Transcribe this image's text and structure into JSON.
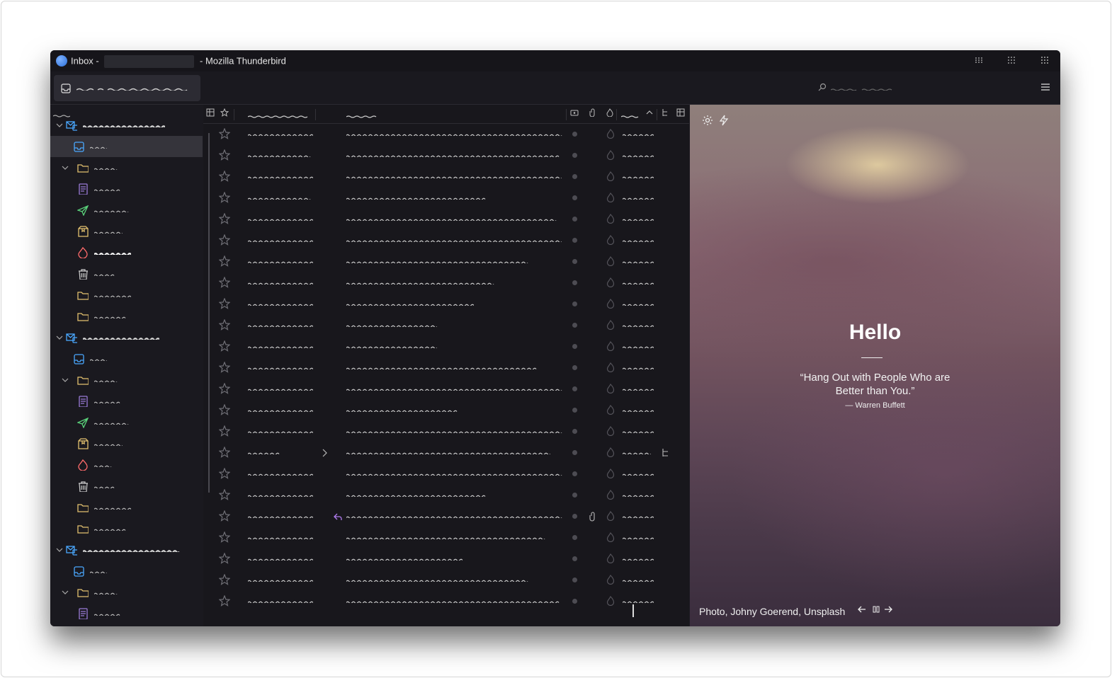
{
  "window": {
    "title_prefix": "Inbox -",
    "title_suffix": "- Mozilla Thunderbird"
  },
  "colors": {
    "background": "#1c1b22",
    "accent_blue": "#4aa8ff",
    "sent_green": "#5ad17a",
    "drafts_purple": "#9a7bd8",
    "junk_red": "#ff6b6b",
    "folder_yellow": "#e3c16f"
  },
  "icons": {
    "app": "thunderbird-icon",
    "menu": "hamburger-menu-icon",
    "search": "search-icon",
    "settings": "gear-icon",
    "quick_action": "lightning-icon"
  },
  "start_page": {
    "greeting": "Hello",
    "quote": "“Hang Out with People Who are Better than You.”",
    "author": "— Warren Buffett",
    "photo_credit": "Photo, Johny Goerend, Unsplash"
  }
}
